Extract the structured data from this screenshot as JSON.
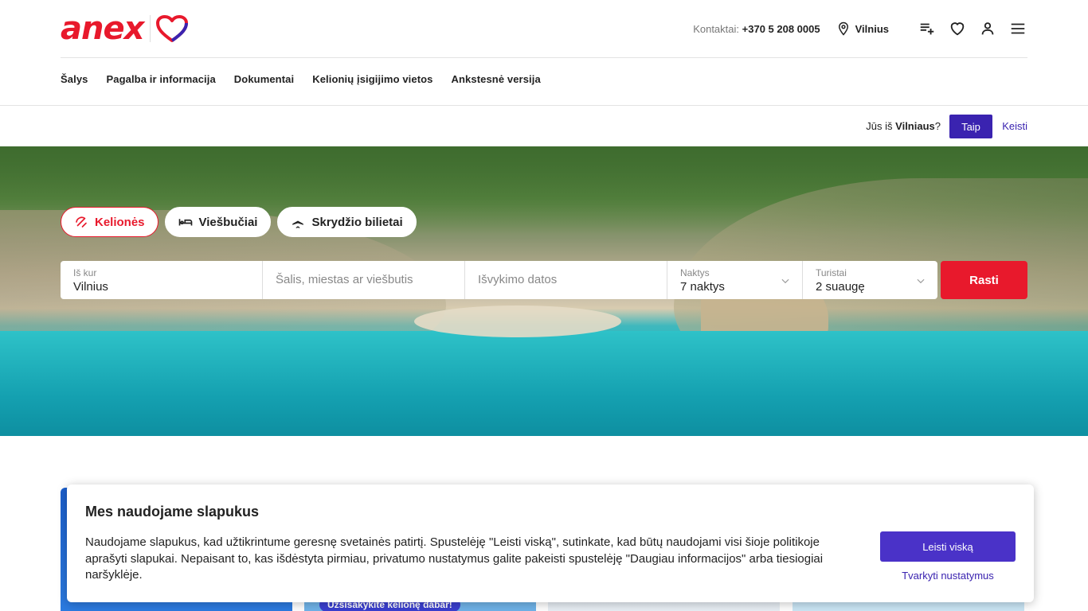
{
  "header": {
    "logo_text": "anex",
    "contact_label": "Kontaktai:",
    "contact_phone": "+370 5 208 0005",
    "city": "Vilnius",
    "icons": [
      "map-pin-icon",
      "playlist-add-icon",
      "heart-icon",
      "user-icon",
      "menu-icon"
    ]
  },
  "nav": {
    "items": [
      "Šalys",
      "Pagalba ir informacija",
      "Dokumentai",
      "Kelionių įsigijimo vietos",
      "Ankstesnė versija"
    ]
  },
  "geo": {
    "question_prefix": "Jūs iš",
    "question_city": "Vilniaus",
    "question_suffix": "?",
    "yes_label": "Taip",
    "change_label": "Keisti"
  },
  "tabs": {
    "items": [
      {
        "label": "Kelionės",
        "icon": "beach-umbrella-icon",
        "active": true
      },
      {
        "label": "Viešbučiai",
        "icon": "bed-icon",
        "active": false
      },
      {
        "label": "Skrydžio bilietai",
        "icon": "airplane-icon",
        "active": false
      }
    ]
  },
  "search": {
    "from_label": "Iš kur",
    "from_value": "Vilnius",
    "destination_placeholder": "Šalis, miestas ar viešbutis",
    "dates_placeholder": "Išvykimo datos",
    "nights_label": "Naktys",
    "nights_value": "7 naktys",
    "tourists_label": "Turistai",
    "tourists_value": "2 suaugę",
    "find_label": "Rasti"
  },
  "cards": {
    "badge": "Užsisakykite kelionę dabar!"
  },
  "cookie": {
    "title": "Mes naudojame slapukus",
    "text": "Naudojame slapukus, kad užtikrintume geresnę svetainės patirtį. Spustelėję \"Leisti viską\", sutinkate, kad būtų naudojami visi šioje politikoje aprašyti slapukai. Nepaisant to, kas išdėstyta pirmiau, privatumo nustatymus galite pakeisti spustelėję \"Daugiau informacijos\" arba tiesiogiai naršyklėje.",
    "accept_label": "Leisti viską",
    "manage_label": "Tvarkyti nustatymus"
  },
  "colors": {
    "brand_red": "#e8192c",
    "brand_purple": "#3a23b0"
  }
}
